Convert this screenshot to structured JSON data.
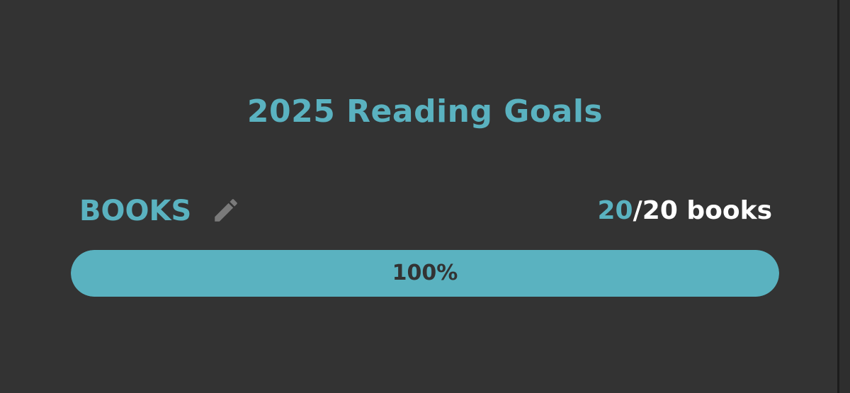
{
  "colors": {
    "background": "#333333",
    "accent": "#5ab2c0",
    "text_light": "#ffffff",
    "text_dark": "#333333",
    "icon_gray": "#7a7a7a"
  },
  "header": {
    "title": "2025 Reading Goals"
  },
  "goal": {
    "label": "BOOKS",
    "edit_icon": "pencil-icon",
    "current": "20",
    "separator": "/",
    "target_text": "20 books",
    "progress_fraction": 1.0,
    "progress_label": "100%"
  }
}
